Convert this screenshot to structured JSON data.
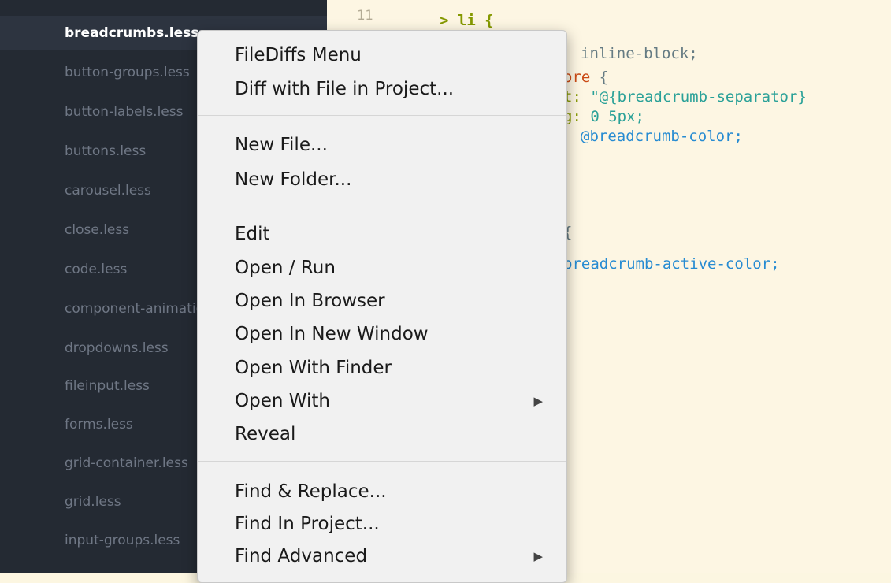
{
  "sidebar": {
    "items": [
      {
        "label": "breadcrumbs.less",
        "active": true
      },
      {
        "label": "button-groups.less"
      },
      {
        "label": "button-labels.less"
      },
      {
        "label": "buttons.less"
      },
      {
        "label": "carousel.less"
      },
      {
        "label": "close.less"
      },
      {
        "label": "code.less"
      },
      {
        "label": "component-animations.less"
      },
      {
        "label": "dropdowns.less"
      },
      {
        "label": "fileinput.less"
      },
      {
        "label": "forms.less"
      },
      {
        "label": "grid-container.less"
      },
      {
        "label": "grid.less"
      },
      {
        "label": "input-groups.less"
      }
    ]
  },
  "editor": {
    "line_number": "11",
    "lines": {
      "l1": "> li {",
      "l2": "inline-block;",
      "l3a": "ore",
      "l3b": " {",
      "l4a": "t: ",
      "l4b": "\"@{breadcrumb-separator}",
      "l5a": "g: ",
      "l5b": "0 5px;",
      "l6": "@breadcrumb-color;",
      "l7": "{",
      "l8": "breadcrumb-active-color;"
    }
  },
  "menu": {
    "items": {
      "filediffs_menu": "FileDiffs Menu",
      "diff_with_file": "Diff with File in Project...",
      "new_file": "New File...",
      "new_folder": "New Folder...",
      "edit": "Edit",
      "open_run": "Open / Run",
      "open_in_browser": "Open In Browser",
      "open_in_new_window": "Open In New Window",
      "open_with_finder": "Open With Finder",
      "open_with": "Open With",
      "reveal": "Reveal",
      "find_replace": "Find & Replace...",
      "find_in_project": "Find In Project...",
      "find_advanced": "Find Advanced"
    },
    "submenu_arrow": "▶"
  }
}
